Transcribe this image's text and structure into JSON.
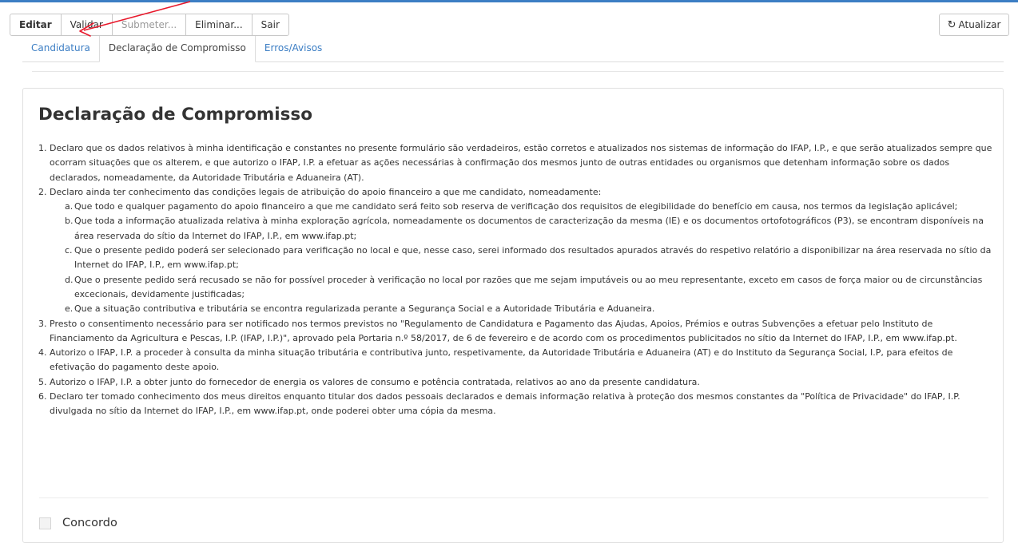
{
  "toolbar": {
    "buttons": [
      {
        "label": "Editar"
      },
      {
        "label": "Validar"
      },
      {
        "label": "Submeter..."
      },
      {
        "label": "Eliminar..."
      },
      {
        "label": "Sair"
      }
    ],
    "refresh_label": "Atualizar",
    "refresh_icon": "refresh-icon"
  },
  "tabs": [
    {
      "label": "Candidatura"
    },
    {
      "label": "Declaração de Compromisso",
      "active": true
    },
    {
      "label": "Erros/Avisos"
    }
  ],
  "declaration": {
    "title": "Declaração de Compromisso",
    "items": [
      {
        "num": "1.",
        "text": "Declaro que os dados relativos à minha identificação e constantes no presente formulário são verdadeiros, estão corretos e atualizados nos sistemas de informação do IFAP, I.P., e que serão atualizados sempre que ocorram situações que os alterem, e que autorizo o IFAP, I.P. a efetuar as ações necessárias à confirmação dos mesmos junto de outras entidades ou organismos que detenham informação sobre os dados declarados, nomeadamente, da Autoridade Tributária e Aduaneira (AT)."
      },
      {
        "num": "2.",
        "text": "Declaro ainda ter conhecimento das condições legais de atribuição do apoio financeiro a que me candidato, nomeadamente:",
        "subitems": [
          {
            "num": "a.",
            "text": "Que todo e qualquer pagamento do apoio financeiro a que me candidato será feito sob reserva de verificação dos requisitos de elegibilidade do benefício em causa, nos termos da legislação aplicável;"
          },
          {
            "num": "b.",
            "text": "Que toda a informação atualizada relativa à minha exploração agrícola, nomeadamente os documentos de caracterização da mesma (IE) e os documentos ortofotográficos (P3), se encontram disponíveis na área reservada do sítio da Internet do IFAP, I.P., em www.ifap.pt;"
          },
          {
            "num": "c.",
            "text": "Que o presente pedido poderá ser selecionado para verificação no local e que, nesse caso, serei informado dos resultados apurados através do respetivo relatório a disponibilizar na área reservada no sítio da Internet do IFAP, I.P., em www.ifap.pt;"
          },
          {
            "num": "d.",
            "text": "Que o presente pedido será recusado se não for possível proceder à verificação no local por razões que me sejam imputáveis ou ao meu representante, exceto em casos de força maior ou de circunstâncias excecionais, devidamente justificadas;"
          },
          {
            "num": "e.",
            "text": "Que a situação contributiva e tributária se encontra regularizada perante a Segurança Social e a Autoridade Tributária e Aduaneira."
          }
        ]
      },
      {
        "num": "3.",
        "text": "Presto o consentimento necessário para ser notificado nos termos previstos no \"Regulamento de Candidatura e Pagamento das Ajudas, Apoios, Prémios e outras Subvenções a efetuar pelo Instituto de Financiamento da Agricultura e Pescas, I.P. (IFAP, I.P.)\", aprovado pela Portaria n.º 58/2017, de 6 de fevereiro e de acordo com os procedimentos publicitados no sítio da Internet do IFAP, I.P., em www.ifap.pt."
      },
      {
        "num": "4.",
        "text": "Autorizo o IFAP, I.P. a proceder à consulta da minha situação tributária e contributiva junto, respetivamente, da Autoridade Tributária e Aduaneira (AT) e do Instituto da Segurança Social, I.P, para efeitos de efetivação do pagamento deste apoio."
      },
      {
        "num": "5.",
        "text": "Autorizo o IFAP, I.P. a obter junto do fornecedor de energia os valores de consumo e potência contratada, relativos ao ano da presente candidatura."
      },
      {
        "num": "6.",
        "text": "Declaro ter tomado conhecimento dos meus direitos enquanto titular dos dados pessoais declarados e demais informação relativa à proteção dos mesmos constantes da \"Política de Privacidade\" do IFAP, I.P. divulgada no sítio da Internet do IFAP, I.P., em www.ifap.pt, onde poderei obter uma cópia da mesma."
      }
    ],
    "agree_label": "Concordo",
    "agree_checked": false
  },
  "annotation": {
    "color": "#e8192c"
  }
}
